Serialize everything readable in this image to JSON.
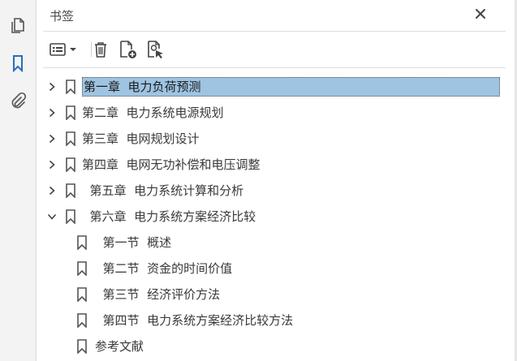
{
  "panel": {
    "title": "书签"
  },
  "icons": {
    "rail": [
      "pages-icon",
      "bookmark-icon",
      "attachment-icon"
    ],
    "toolbar": [
      "options-menu-icon",
      "trash-icon",
      "new-bookmark-icon",
      "bookmark-from-selection-icon"
    ],
    "close": "close-icon"
  },
  "colors": {
    "accent": "#2a6ebb",
    "selection": "#9ec4e2"
  },
  "bookmarks": [
    {
      "label": "第一章  电力负荷预测",
      "level": 0,
      "expandable": true,
      "expanded": false,
      "selected": true
    },
    {
      "label": "第二章  电力系统电源规划",
      "level": 0,
      "expandable": true,
      "expanded": false,
      "selected": false
    },
    {
      "label": "第三章  电网规划设计",
      "level": 0,
      "expandable": true,
      "expanded": false,
      "selected": false
    },
    {
      "label": "第四章  电网无功补偿和电压调整",
      "level": 0,
      "expandable": true,
      "expanded": false,
      "selected": false
    },
    {
      "label": "  第五章  电力系统计算和分析",
      "level": 0,
      "expandable": true,
      "expanded": false,
      "selected": false
    },
    {
      "label": "  第六章  电力系统方案经济比较",
      "level": 0,
      "expandable": true,
      "expanded": true,
      "selected": false
    },
    {
      "label": "  第一节  概述",
      "level": 1,
      "expandable": false,
      "expanded": false,
      "selected": false
    },
    {
      "label": "  第二节  资金的时间价值",
      "level": 1,
      "expandable": false,
      "expanded": false,
      "selected": false
    },
    {
      "label": "  第三节  经济评价方法",
      "level": 1,
      "expandable": false,
      "expanded": false,
      "selected": false
    },
    {
      "label": "  第四节  电力系统方案经济比较方法",
      "level": 1,
      "expandable": false,
      "expanded": false,
      "selected": false
    },
    {
      "label": "参考文献",
      "level": 1,
      "expandable": false,
      "expanded": false,
      "selected": false
    }
  ]
}
